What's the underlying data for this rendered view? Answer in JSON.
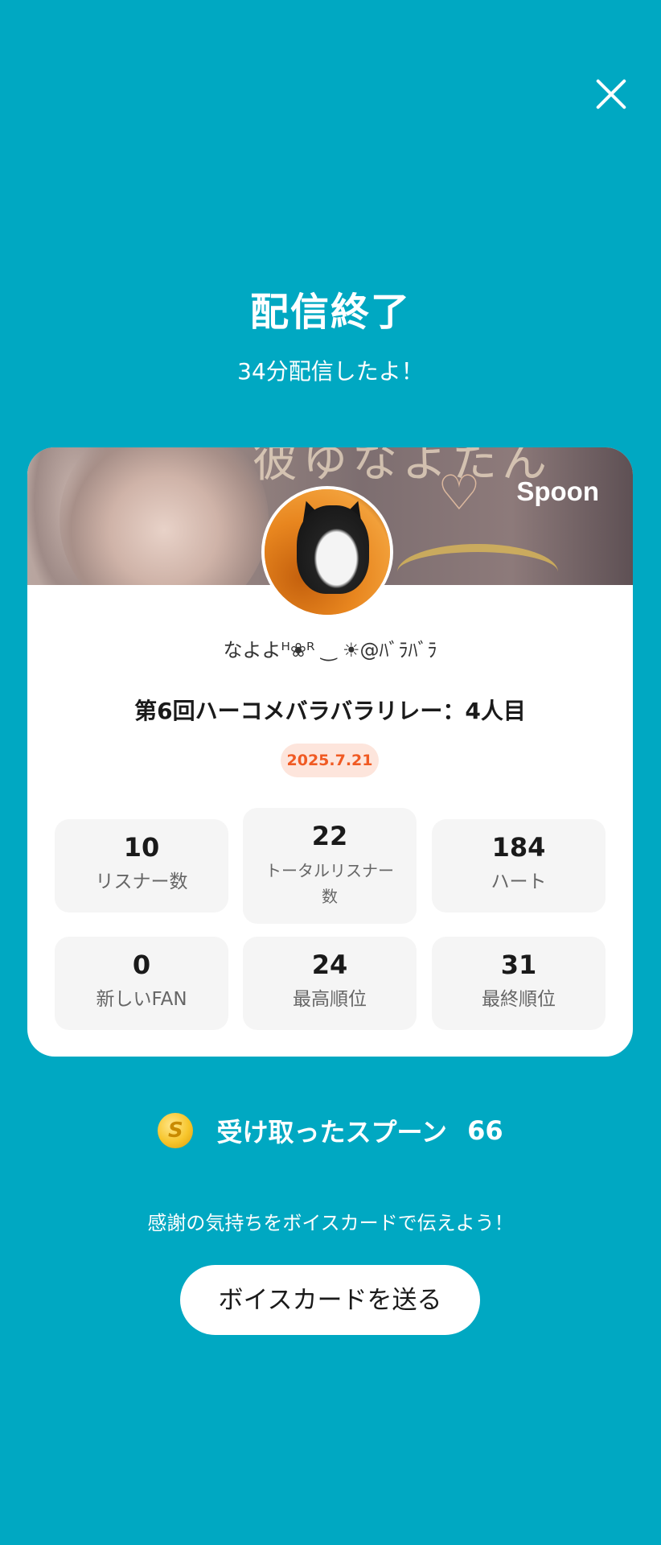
{
  "header": {
    "close_icon": "close-icon",
    "title": "配信終了",
    "subtitle": "34分配信したよ！"
  },
  "card": {
    "brand_logo": "Spoon",
    "username": "なよよᴴ❀ᴿ ‿ ☀@ﾊﾞﾗﾊﾞﾗ",
    "live_title": "第6回ハーコメバラバラリレー：4人目",
    "date": "2025.7.21",
    "stats": [
      {
        "value": "10",
        "label": "リスナー数"
      },
      {
        "value": "22",
        "label": "トータルリスナー数"
      },
      {
        "value": "184",
        "label": "ハート"
      },
      {
        "value": "0",
        "label": "新しいFAN"
      },
      {
        "value": "24",
        "label": "最高順位"
      },
      {
        "value": "31",
        "label": "最終順位"
      }
    ]
  },
  "spoons": {
    "coin_icon": "spoon-coin-icon",
    "coin_letter": "S",
    "label": "受け取ったスプーン",
    "count": "66"
  },
  "voice_card": {
    "prompt": "感謝の気持ちをボイスカードで伝えよう！",
    "button_label": "ボイスカードを送る"
  },
  "colors": {
    "background": "#00a8c2",
    "date_accent": "#f05a23",
    "date_badge_bg": "#fde5dc"
  }
}
